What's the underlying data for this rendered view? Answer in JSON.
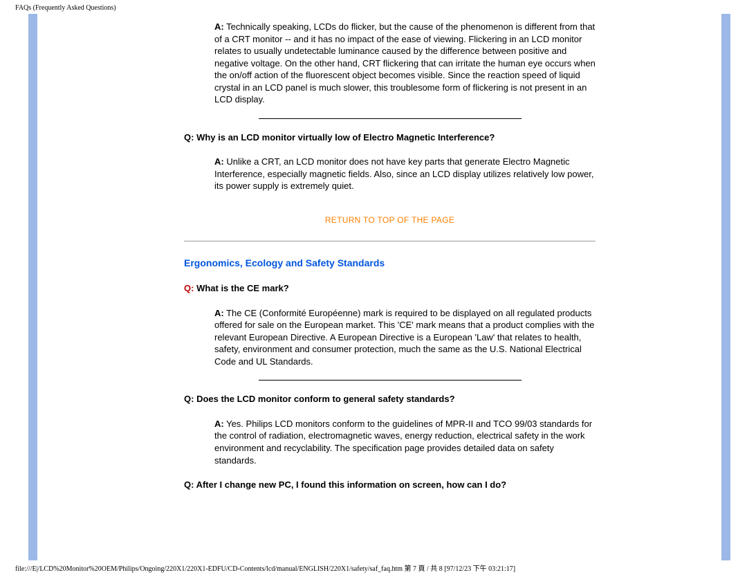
{
  "header": "FAQs (Frequently Asked Questions)",
  "faq1": {
    "a_label": "A:",
    "a_text": " Technically speaking, LCDs do flicker, but the cause of the phenomenon is different from that of a CRT monitor -- and it has no impact of the ease of viewing. Flickering in an LCD monitor relates to usually undetectable luminance caused by the difference between positive and negative voltage. On the other hand, CRT flickering that can irritate the human eye occurs when the on/off action of the fluorescent object becomes visible. Since the reaction speed of liquid crystal in an LCD panel is much slower, this troublesome form of flickering is not present in an LCD display."
  },
  "faq2": {
    "q_label": "Q:",
    "q_text": " Why is an LCD monitor virtually low of Electro Magnetic Interference?",
    "a_label": "A:",
    "a_text": " Unlike a CRT, an LCD monitor does not have key parts that generate Electro Magnetic Interference, especially magnetic fields. Also, since an LCD display utilizes relatively low power, its power supply is extremely quiet."
  },
  "return_link": "RETURN TO TOP OF THE PAGE",
  "section_heading": "Ergonomics, Ecology and Safety Standards",
  "faq3": {
    "q_label": "Q:",
    "q_text": " What is the CE mark?",
    "a_label": "A:",
    "a_text": " The CE (Conformité Européenne) mark is required to be displayed on all regulated products offered for sale on the European market. This 'CE' mark means that a product complies with the relevant European Directive. A European Directive is a European 'Law' that relates to health, safety, environment and consumer protection, much the same as the U.S. National Electrical Code and UL Standards."
  },
  "faq4": {
    "q_label": "Q:",
    "q_text": " Does the LCD monitor conform to general safety standards?",
    "a_label": "A:",
    "a_text": " Yes. Philips LCD monitors conform to the guidelines of MPR-II and TCO 99/03 standards for the control of radiation, electromagnetic waves, energy reduction, electrical safety in the work environment and recyclability. The specification page provides detailed data on safety standards."
  },
  "faq5": {
    "q_label": "Q:",
    "q_text": " After I change new PC, I found this information on screen, how can I do?"
  },
  "footer": "file:///E|/LCD%20Monitor%20OEM/Philips/Ongoing/220X1/220X1-EDFU/CD-Contents/lcd/manual/ENGLISH/220X1/safety/saf_faq.htm 第 7 頁 / 共 8  [97/12/23 下午 03:21:17]"
}
